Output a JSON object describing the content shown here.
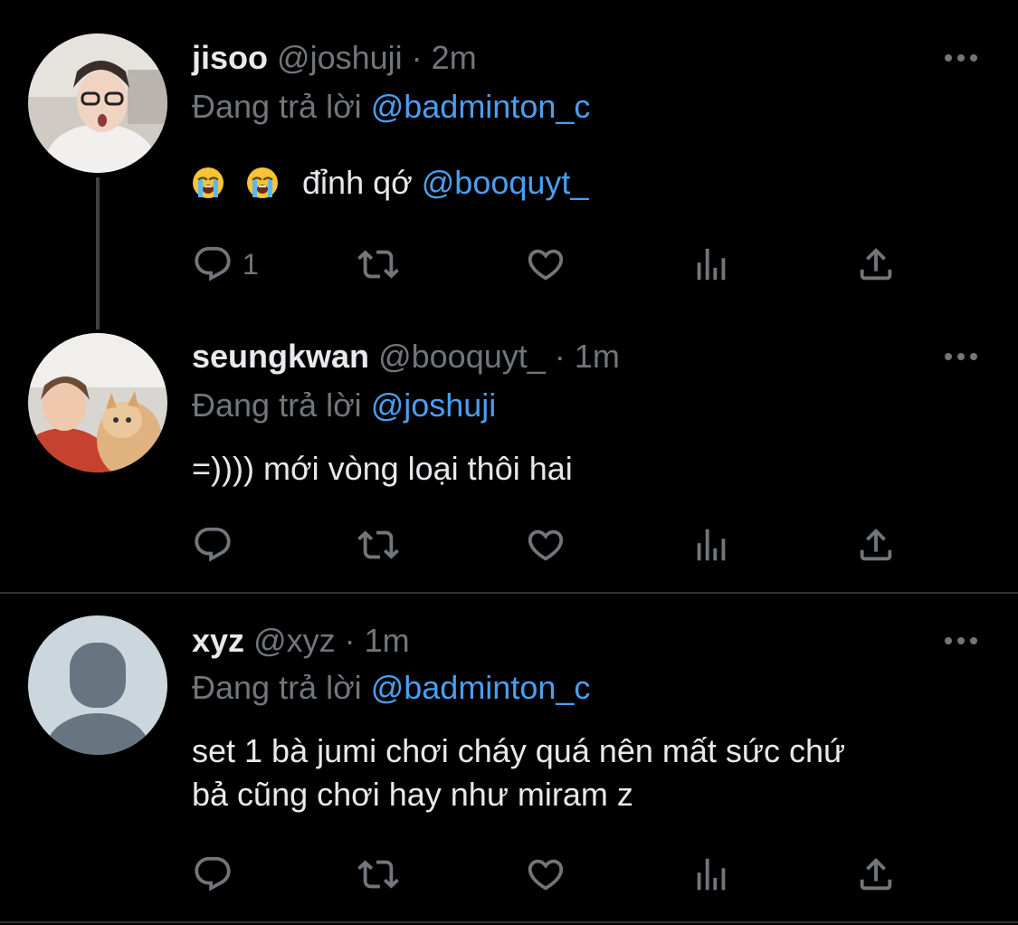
{
  "tweets": [
    {
      "name": "jisoo",
      "handle": "@joshuji",
      "separator": "·",
      "time": "2m",
      "replying_prefix": "Đang trả lời",
      "replying_to": "@badminton_c",
      "text_emoji": [
        "loudly-crying-face",
        "loudly-crying-face"
      ],
      "text": "đỉnh qớ",
      "text_mention": "@booquyt_",
      "reply_count": "1"
    },
    {
      "name": "seungkwan",
      "handle": "@booquyt_",
      "separator": "·",
      "time": "1m",
      "replying_prefix": "Đang trả lời",
      "replying_to": "@joshuji",
      "text": "=)))) mới vòng loại thôi hai",
      "reply_count": ""
    },
    {
      "name": "xyz",
      "handle": "@xyz",
      "separator": "·",
      "time": "1m",
      "replying_prefix": "Đang trả lời",
      "replying_to": "@badminton_c",
      "text_line1": "set 1 bà jumi chơi cháy quá nên mất sức chứ",
      "text_line2": "bả cũng chơi hay như miram z",
      "reply_count": ""
    }
  ],
  "icons": {
    "reply": "reply-icon",
    "retweet": "retweet-icon",
    "like": "heart-icon",
    "views": "analytics-icon",
    "share": "share-icon",
    "more": "more-icon"
  },
  "colors": {
    "background": "#000000",
    "text": "#e7e9ea",
    "secondary": "#71767b",
    "link": "#4a9ff0",
    "divider": "#2f3336"
  }
}
